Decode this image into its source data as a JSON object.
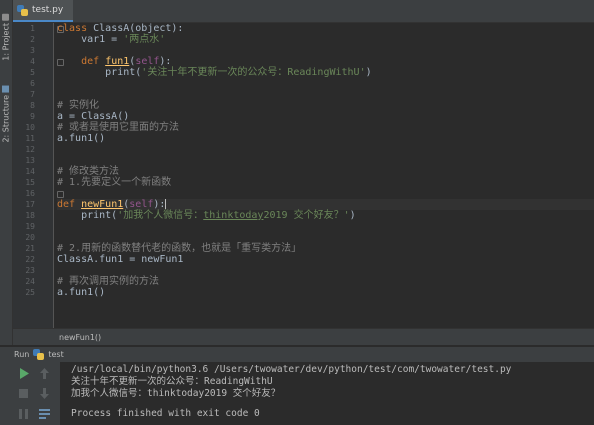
{
  "sidebar": {
    "project_tab": "1: Project",
    "structure_tab": "2: Structure"
  },
  "editor_tab": {
    "filename": "test.py"
  },
  "line_numbers": [
    "1",
    "2",
    "3",
    "4",
    "5",
    "6",
    "7",
    "8",
    "9",
    "10",
    "11",
    "12",
    "13",
    "14",
    "15",
    "16",
    "17",
    "18",
    "19",
    "20",
    "21",
    "22",
    "23",
    "24",
    "25"
  ],
  "code": {
    "l1_kw": "class",
    "l1_rest": " ClassA(object):",
    "l2": "    var1 = ",
    "l2_str": "'两点水'",
    "l4_indent": "    ",
    "l4_kw": "def",
    "l4_fn": "fun1",
    "l4_p1": "(",
    "l4_self": "self",
    "l4_p2": "):",
    "l5_pre": "        print(",
    "l5_str": "'关注十年不更新一次的公众号：ReadingWithU'",
    "l5_post": ")",
    "l8": "# 实例化",
    "l9": "a = ClassA()",
    "l10": "# 或者是使用它里面的方法",
    "l11": "a.fun1()",
    "l14": "# 修改类方法",
    "l15": "# 1.先要定义一个新函数",
    "l16_kw": "def",
    "l16_fn": "newFun1",
    "l16_p1": "(",
    "l16_self": "self",
    "l16_p2": "):",
    "l17_pre": "    print(",
    "l17_str1": "'加我个人微信号：",
    "l17_url": "thinktoday",
    "l17_str2": "2019 交个好友？'",
    "l17_post": ")",
    "l20": "# 2.用新的函数替代老的函数，也就是「重写类方法」",
    "l21": "ClassA.fun1 = newFun1",
    "l23": "# 再次调用实例的方法",
    "l24": "a.fun1()"
  },
  "breadcrumb": "newFun1()",
  "run_panel": {
    "label": "Run",
    "config": "test",
    "output": [
      "/usr/local/bin/python3.6 /Users/twowater/dev/python/test/com/twowater/test.py",
      "关注十年不更新一次的公众号：ReadingWithU",
      "加我个人微信号：thinktoday2019 交个好友？",
      "",
      "Process finished with exit code 0"
    ]
  },
  "colors": {
    "keyword": "#cc7832",
    "string": "#6a8759",
    "function": "#ffc66d",
    "comment": "#808080",
    "run_green": "#59a869"
  }
}
